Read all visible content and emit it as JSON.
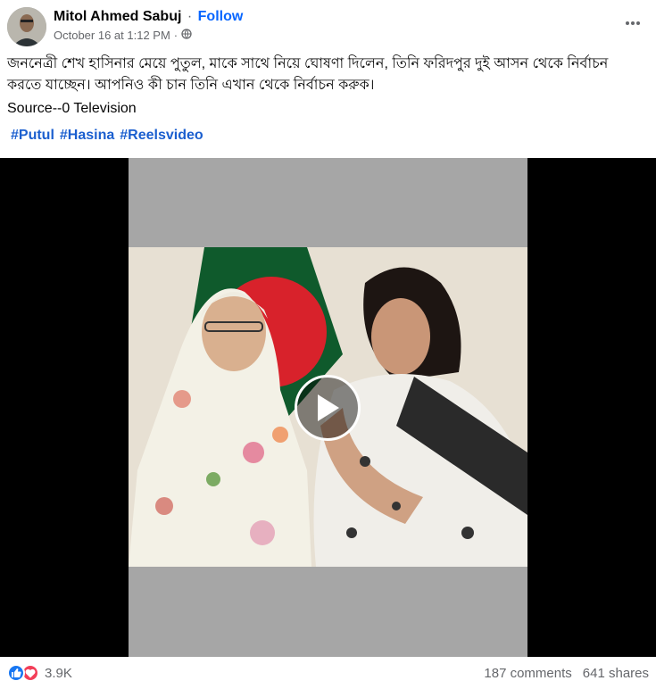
{
  "post": {
    "author": "Mitol Ahmed Sabuj",
    "separator": "·",
    "follow_label": "Follow",
    "timestamp": "October 16 at 1:12 PM",
    "meta_separator": "·",
    "audience_icon": "globe-icon",
    "more_icon": "more-options-icon",
    "text": "জননেত্রী শেখ হাসিনার মেয়ে পুতুল, মাকে সাথে নিয়ে ঘোষণা দিলেন, তিনি ফরিদপুর দুই আসন থেকে নির্বাচন করতে যাচ্ছেন। আপনিও কী চান তিনি এখান থেকে নির্বাচন করুক।",
    "source": "Source--0 Television",
    "hashtags": [
      "#Putul",
      "#Hasina",
      "#Reelsvideo"
    ]
  },
  "video": {
    "play_icon": "play-icon"
  },
  "footer": {
    "reaction_icons": [
      "like-icon",
      "love-icon"
    ],
    "reaction_count": "3.9K",
    "comments": "187 comments",
    "shares": "641 shares"
  },
  "colors": {
    "link": "#0866ff",
    "secondary_text": "#65676b",
    "like": "#1877f2",
    "love": "#f33e58"
  }
}
